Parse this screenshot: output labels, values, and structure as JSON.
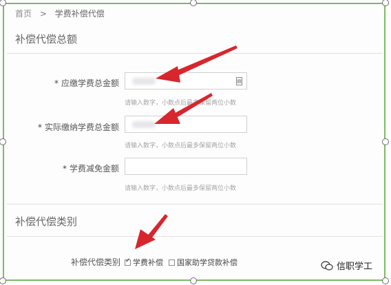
{
  "breadcrumb": {
    "home": "首页",
    "separator": ">",
    "current": "学费补偿代偿"
  },
  "sections": {
    "total": {
      "title": "补偿代偿总额"
    },
    "category": {
      "title": "补偿代偿类别"
    }
  },
  "form": {
    "fields": [
      {
        "label": "应缴学费总金额",
        "hint": "请输入数字，小数点后最多保留两位小数"
      },
      {
        "label": "实际缴纳学费总金额",
        "hint": "请输入数字，小数点后最多保留两位小数"
      },
      {
        "label": "学费减免金额",
        "hint": "请输入数字，小数点后最多保留两位小数"
      }
    ],
    "required_mark": "*",
    "calculator_icon": "calculator-icon"
  },
  "category": {
    "label": "补偿代偿类别",
    "options": [
      {
        "label": "学费补偿",
        "checked": true
      },
      {
        "label": "国家助学贷款补偿",
        "checked": false
      }
    ]
  },
  "watermark": {
    "text": "信职学工",
    "icon": "wechat-icon"
  },
  "colors": {
    "selection_border": "#7cba64",
    "arrow": "#d8262d",
    "hint": "#a5a5a5"
  }
}
